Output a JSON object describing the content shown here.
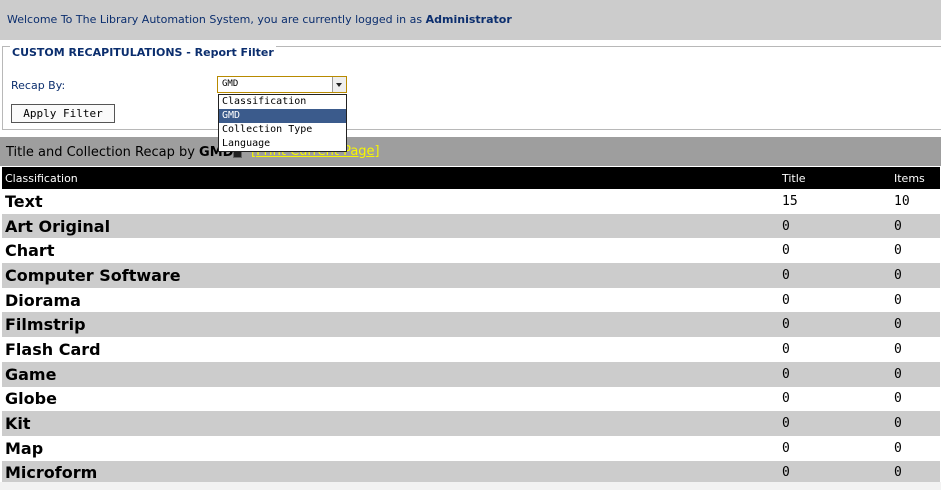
{
  "header": {
    "welcome_text": "Welcome To The Library Automation System, you are currently logged in as",
    "user": "Administrator"
  },
  "filter": {
    "legend": "CUSTOM RECAPITULATIONS - Report Filter",
    "recap_label": "Recap By:",
    "selected": "GMD",
    "options": [
      "Classification",
      "GMD",
      "Collection Type",
      "Language"
    ],
    "apply_label": "Apply Filter"
  },
  "recap": {
    "title_prefix": "Title and Collection Recap by",
    "title_by": "GMD",
    "print_link": "[Print Current Page]"
  },
  "table": {
    "columns": [
      "Classification",
      "Title",
      "Items"
    ],
    "rows": [
      {
        "name": "Text",
        "title": "15",
        "items": "10"
      },
      {
        "name": "Art Original",
        "title": "0",
        "items": "0"
      },
      {
        "name": "Chart",
        "title": "0",
        "items": "0"
      },
      {
        "name": "Computer Software",
        "title": "0",
        "items": "0"
      },
      {
        "name": "Diorama",
        "title": "0",
        "items": "0"
      },
      {
        "name": "Filmstrip",
        "title": "0",
        "items": "0"
      },
      {
        "name": "Flash Card",
        "title": "0",
        "items": "0"
      },
      {
        "name": "Game",
        "title": "0",
        "items": "0"
      },
      {
        "name": "Globe",
        "title": "0",
        "items": "0"
      },
      {
        "name": "Kit",
        "title": "0",
        "items": "0"
      },
      {
        "name": "Map",
        "title": "0",
        "items": "0"
      },
      {
        "name": "Microform",
        "title": "0",
        "items": "0"
      }
    ]
  },
  "colors": {
    "header_bg": "#cccccc",
    "link_blue": "#0b2e6e",
    "recap_bar": "#9e9e9e",
    "print_link": "#f7f700",
    "table_header": "#000000",
    "row_alt": "#cccccc",
    "dropdown_selected": "#3b5b8c"
  }
}
